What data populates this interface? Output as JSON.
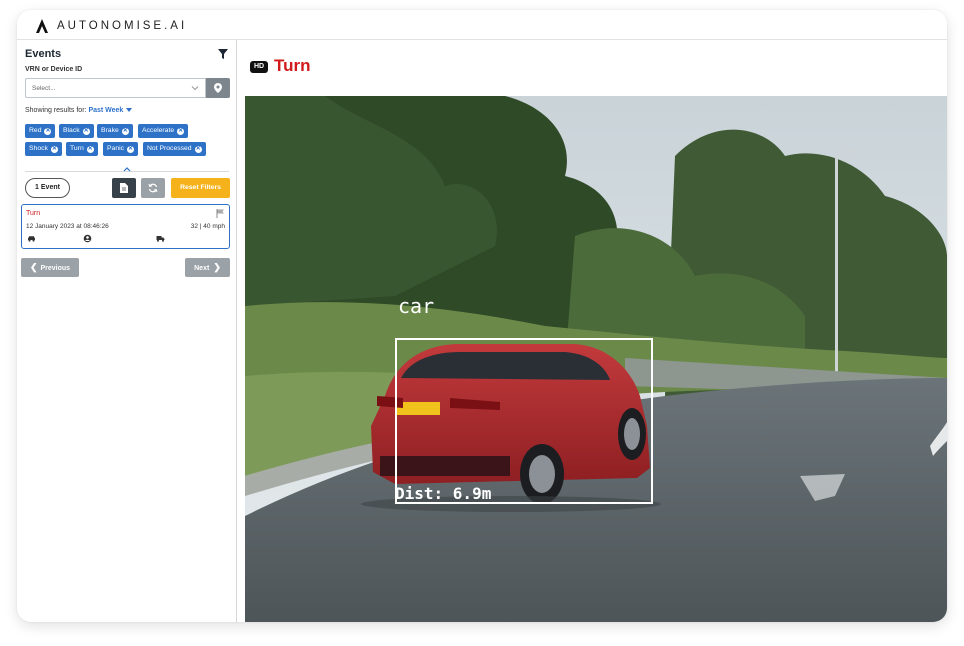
{
  "app": {
    "brand": "AUTONOMISE.AI"
  },
  "sidebar": {
    "title": "Events",
    "vrn_label": "VRN or Device ID",
    "vrn_placeholder": "Select...",
    "results_prefix": "Showing results for:",
    "results_value": "Past Week",
    "filter_chips": [
      "Red",
      "Black",
      "Brake",
      "Accelerate",
      "Shock",
      "Turn",
      "Panic",
      "Not Processed"
    ],
    "event_count": "1 Event",
    "reset_label": "Reset Filters",
    "events": [
      {
        "type": "Turn",
        "datetime": "12 January 2023 at 08:46:26",
        "speed": "32 | 40 mph"
      }
    ],
    "prev_label": "Previous",
    "next_label": "Next"
  },
  "main": {
    "hd_badge": "HD",
    "title": "Turn",
    "detection": {
      "label": "car",
      "distance": "Dist: 6.9m"
    }
  },
  "colors": {
    "accent": "#2e72c8",
    "event_red": "#d21a1a",
    "reset_yellow": "#f5b21b",
    "car_red": "#b0262b"
  },
  "icons": [
    "filter-icon",
    "chevron-down-icon",
    "map-pin-icon",
    "remove-chip-icon",
    "document-icon",
    "refresh-icon",
    "flag-icon",
    "car-icon",
    "driver-icon",
    "truck-icon",
    "chevron-left-icon",
    "chevron-right-icon"
  ]
}
